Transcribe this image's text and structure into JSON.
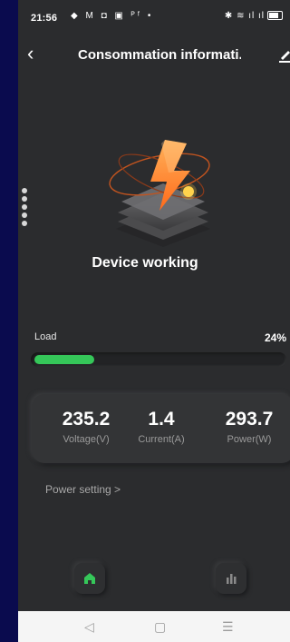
{
  "status_bar": {
    "time": "21:56",
    "notification_icons": "◆ M ◘ ▣ ᴾᶠ •",
    "system_icons": "✱ ≋ ıl ıl"
  },
  "header": {
    "back_label": "‹",
    "title": "Consommation informati..."
  },
  "device": {
    "status": "Device working"
  },
  "load": {
    "label": "Load",
    "value": "24%",
    "percent": 24,
    "fill_color": "#35c759"
  },
  "metrics": [
    {
      "value": "235.2",
      "label": "Voltage(V)"
    },
    {
      "value": "1.4",
      "label": "Current(A)"
    },
    {
      "value": "293.7",
      "label": "Power(W)"
    }
  ],
  "power_setting": {
    "label": "Power setting >"
  },
  "bottom_nav": {
    "home_icon": "home-icon",
    "stats_icon": "bar-chart-icon",
    "active_color": "#35c759"
  },
  "system_nav": {
    "back": "◁",
    "home": "▢",
    "menu": "☰"
  }
}
